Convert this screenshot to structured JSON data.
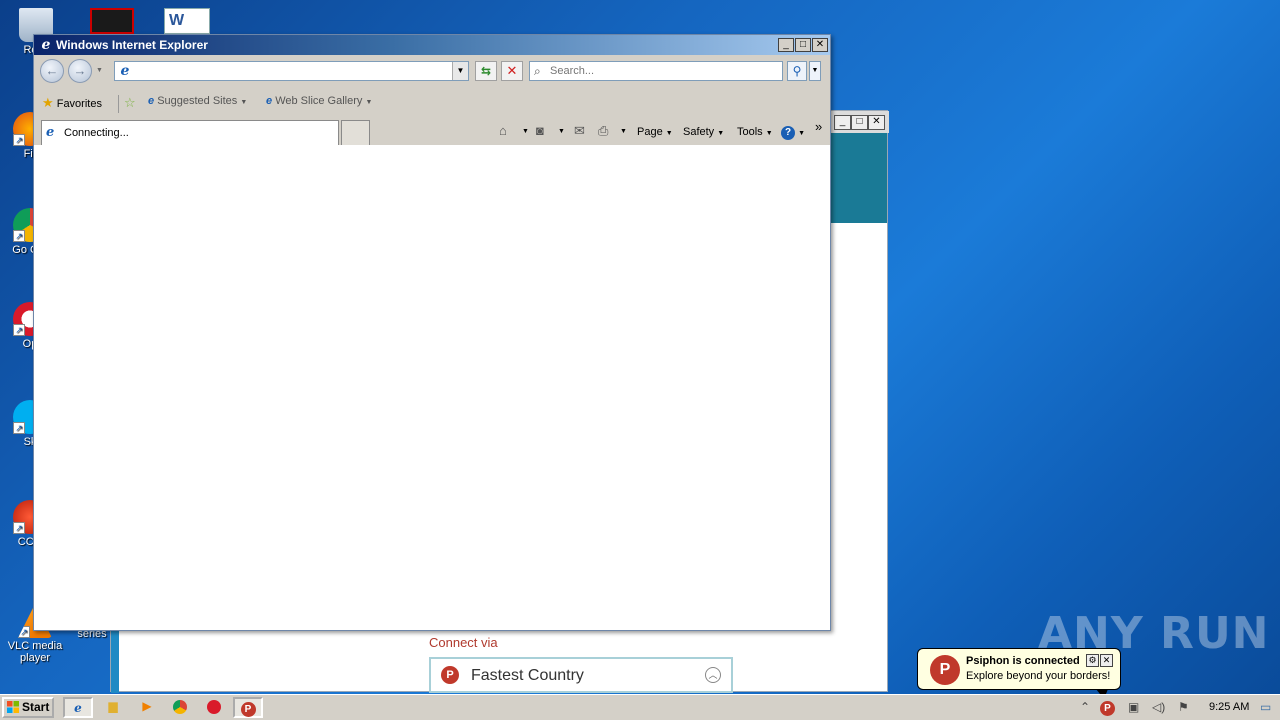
{
  "desktop": {
    "icons": [
      {
        "label": "Recy",
        "icon": "recycle-bin-icon"
      },
      {
        "label": "Fir",
        "icon": "firefox-icon"
      },
      {
        "label": "Go Chr",
        "icon": "chrome-icon"
      },
      {
        "label": "Op",
        "icon": "opera-icon"
      },
      {
        "label": "Sk",
        "icon": "skype-icon"
      },
      {
        "label": "CCle",
        "icon": "ccleaner-icon"
      },
      {
        "label": "VLC media player",
        "icon": "vlc-icon"
      },
      {
        "label": "series",
        "icon": "file-icon"
      }
    ],
    "watermark": "ANY RUN"
  },
  "ie": {
    "title": "Windows Internet Explorer",
    "address_value": "",
    "search_placeholder": "Search...",
    "favorites_label": "Favorites",
    "suggested_sites": "Suggested Sites",
    "web_slice_gallery": "Web Slice Gallery",
    "tab_title": "Connecting...",
    "commands": {
      "page": "Page",
      "safety": "Safety",
      "tools": "Tools"
    },
    "chevron": "»"
  },
  "psiphon": {
    "connect_via": "Connect via",
    "country": "Fastest Country"
  },
  "balloon": {
    "title": "Psiphon is connected",
    "text": "Explore beyond your borders!"
  },
  "taskbar": {
    "start_label": "Start",
    "clock": "9:25 AM"
  },
  "colors": {
    "titlebar_start": "#0a246a",
    "psiphon_red": "#c0392b",
    "psiphon_teal": "#1a7a96",
    "desktop_blue": "#1566c0"
  }
}
